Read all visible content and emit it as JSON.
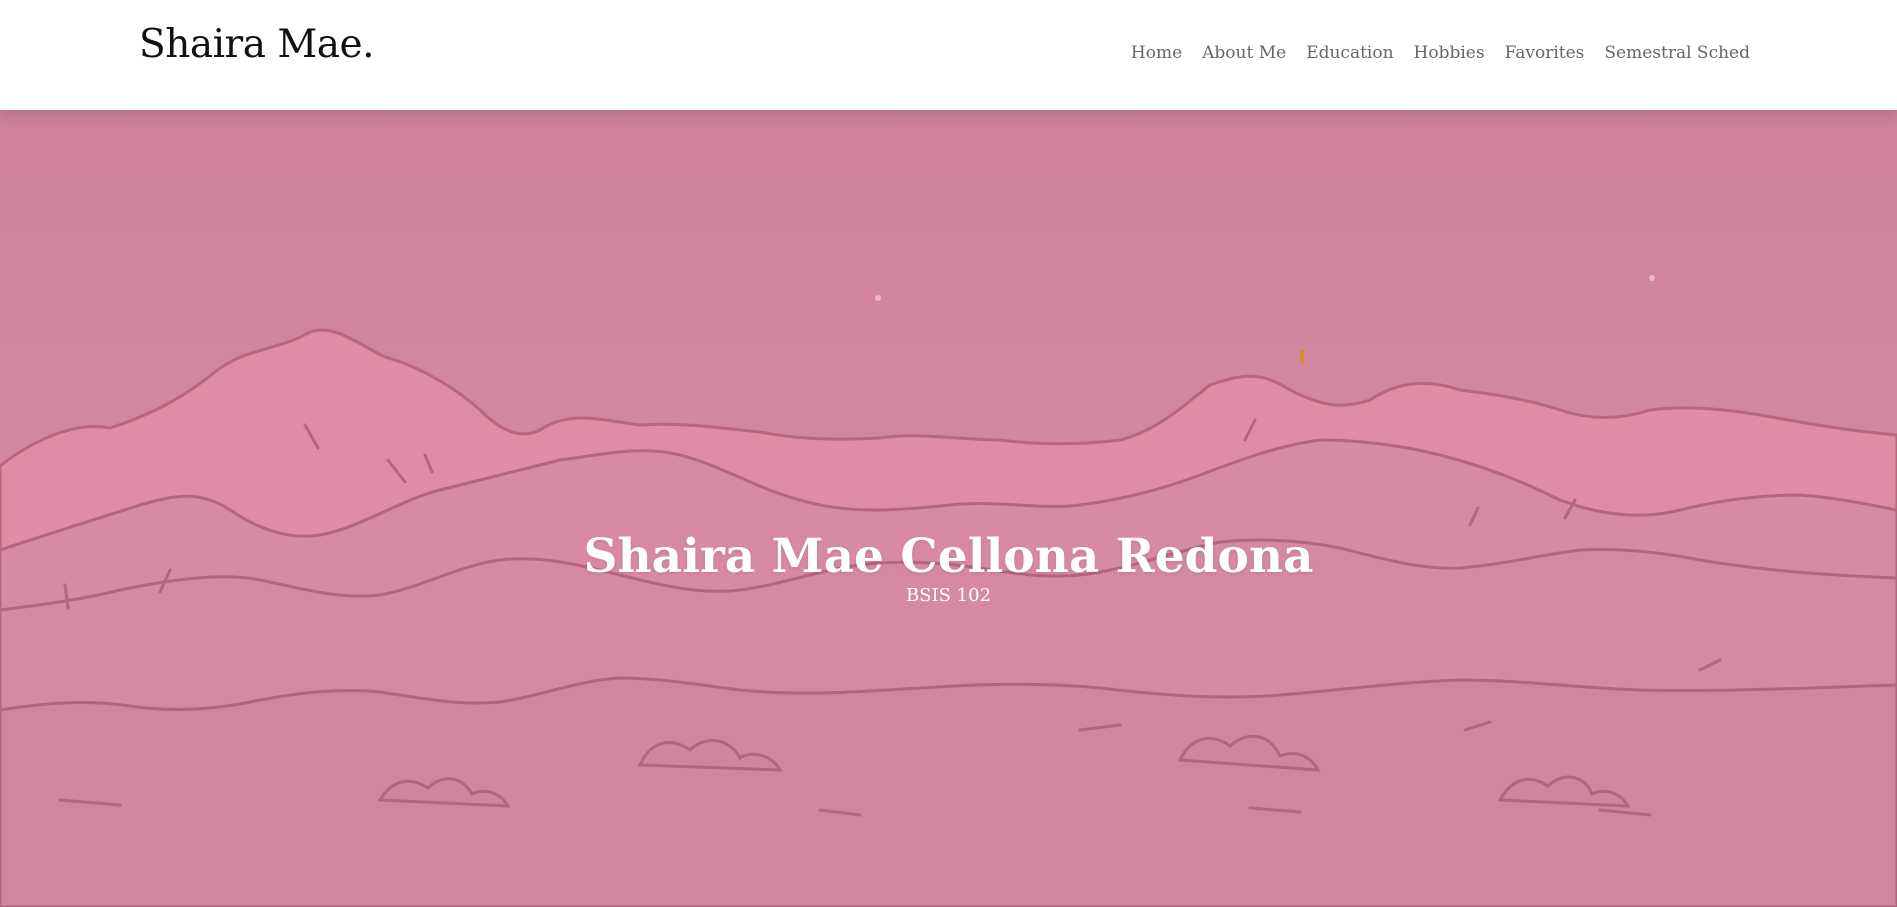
{
  "brand": {
    "name": "Shaira Mae."
  },
  "nav": {
    "items": [
      {
        "label": "Home"
      },
      {
        "label": "About Me"
      },
      {
        "label": "Education"
      },
      {
        "label": "Hobbies"
      },
      {
        "label": "Favorites"
      },
      {
        "label": "Semestral Sched"
      }
    ]
  },
  "hero": {
    "title": "Shaira Mae Cellona Redona",
    "subtitle": "BSIS 102",
    "background_image": "pink-mountain-landscape-illustration"
  },
  "colors": {
    "header_bg": "#ffffff",
    "brand_text": "#111111",
    "nav_text": "#666666",
    "hero_sky": "#d3869f",
    "hero_mountain_light": "#e48ea8",
    "hero_line": "#b5667f",
    "hero_text": "#ffffff"
  }
}
